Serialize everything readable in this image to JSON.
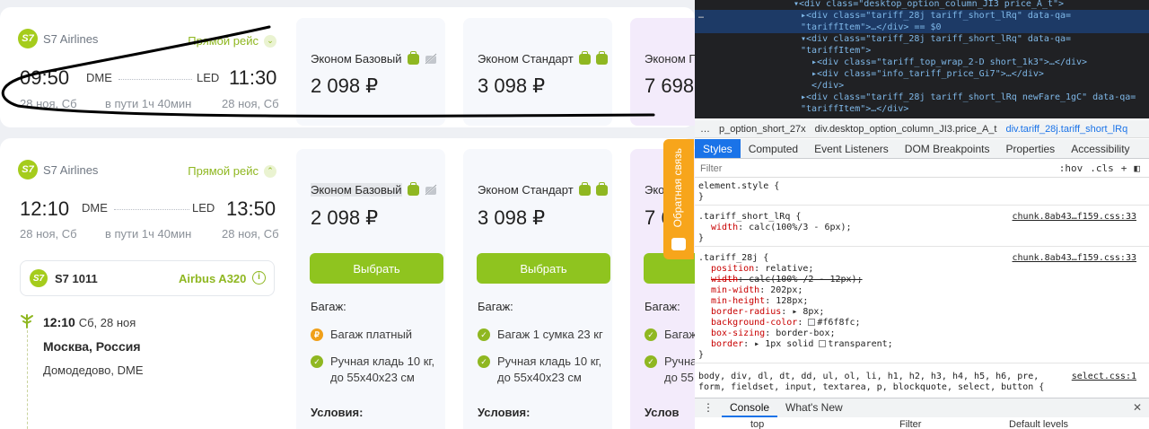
{
  "flights": [
    {
      "airline": "S7 Airlines",
      "logo": "S7",
      "direct_label": "Прямой рейс",
      "chevron": "⌄",
      "depart_time": "09:50",
      "depart_code": "DME",
      "arrive_code": "LED",
      "arrive_time": "11:30",
      "depart_date": "28 ноя, Сб",
      "duration": "в пути 1ч 40мин",
      "arrive_date": "28 ноя, Сб",
      "tariffs": [
        {
          "title": "Эконом Базовый",
          "price": "2 098 ₽"
        },
        {
          "title": "Эконом Стандарт",
          "price": "3 098 ₽"
        },
        {
          "title": "Эконом Г",
          "price": "7 698"
        }
      ]
    },
    {
      "airline": "S7 Airlines",
      "logo": "S7",
      "direct_label": "Прямой рейс",
      "chevron": "⌃",
      "depart_time": "12:10",
      "depart_code": "DME",
      "arrive_code": "LED",
      "arrive_time": "13:50",
      "depart_date": "28 ноя, Сб",
      "duration": "в пути 1ч 40мин",
      "arrive_date": "28 ноя, Сб",
      "tariffs": [
        {
          "title": "Эконом Базовый",
          "price": "2 098 ₽",
          "select": "Выбрать",
          "baggage_label": "Багаж:",
          "f1": "Багаж платный",
          "f2": "Ручная кладь 10 кг,",
          "f2b": "до 55x40x23 см",
          "conditions": "Условия:"
        },
        {
          "title": "Эконом Стандарт",
          "price": "3 098 ₽",
          "select": "Выбрать",
          "baggage_label": "Багаж:",
          "f1": "Багаж 1 сумка 23 кг",
          "f2": "Ручная кладь 10 кг,",
          "f2b": "до 55x40x23 см",
          "conditions": "Условия:"
        },
        {
          "title": "Эконом",
          "price": "7 6",
          "select": "",
          "baggage_label": "Багаж:",
          "f1": "Багаж",
          "f2": "Ручна",
          "f2b": "до 55",
          "conditions": "Услов"
        }
      ],
      "segment": {
        "flight_no": "S7 1011",
        "aircraft": "Airbus A320",
        "time": "12:10",
        "date": "Сб, 28 ноя",
        "city": "Москва, Россия",
        "airport": "Домодедово, DME"
      }
    }
  ],
  "feedback_label": "Обратная связь",
  "devtools": {
    "dom_lines": [
      {
        "t": "▾<div class=\"desktop_option_column_JI3 price_A_t\">",
        "indent": 110,
        "sel": false
      },
      {
        "t": "▸<div class=\"tariff_28j tariff_short_lRq\" data-qa=",
        "indent": 118,
        "sel": true,
        "prefix": "…"
      },
      {
        "t": "\"tariffItem\">…</div> == $0",
        "indent": 118,
        "sel": true
      },
      {
        "t": "▾<div class=\"tariff_28j tariff_short_lRq\" data-qa=",
        "indent": 118,
        "sel": false
      },
      {
        "t": "\"tariffItem\">",
        "indent": 118,
        "sel": false
      },
      {
        "t": "▸<div class=\"tariff_top_wrap_2-D short_1k3\">…</div>",
        "indent": 130,
        "sel": false
      },
      {
        "t": "▸<div class=\"info_tariff_price_Gi7\">…</div>",
        "indent": 130,
        "sel": false
      },
      {
        "t": "</div>",
        "indent": 130,
        "sel": false
      },
      {
        "t": "▸<div class=\"tariff_28j tariff_short_lRq newFare_1gC\" data-qa=",
        "indent": 118,
        "sel": false
      },
      {
        "t": "\"tariffItem\">…</div>",
        "indent": 118,
        "sel": false
      }
    ],
    "breadcrumbs": [
      "…",
      "p_option_short_27x",
      "div.desktop_option_column_JI3.price_A_t",
      "div.tariff_28j.tariff_short_lRq"
    ],
    "tabs": [
      "Styles",
      "Computed",
      "Event Listeners",
      "DOM Breakpoints",
      "Properties",
      "Accessibility"
    ],
    "filter_placeholder": "Filter",
    "filter_tools": [
      ":hov",
      ".cls",
      "+"
    ],
    "rules": [
      {
        "selector": "element.style {",
        "source": "",
        "decls": [],
        "close": "}"
      },
      {
        "selector": ".tariff_short_lRq {",
        "source": "chunk.8ab43…f159.css:33",
        "decls": [
          {
            "p": "width",
            "v": "calc(100%/3 - 6px);",
            "strike": false
          }
        ],
        "close": "}"
      },
      {
        "selector": ".tariff_28j {",
        "source": "chunk.8ab43…f159.css:33",
        "decls": [
          {
            "p": "position",
            "v": "relative;",
            "strike": false
          },
          {
            "p": "width",
            "v": "calc(100% /2 - 12px);",
            "strike": true
          },
          {
            "p": "min-width",
            "v": "202px;",
            "strike": false
          },
          {
            "p": "min-height",
            "v": "128px;",
            "strike": false
          },
          {
            "p": "border-radius",
            "v": "▸ 8px;",
            "strike": false
          },
          {
            "p": "background-color",
            "v": "#f6f8fc;",
            "strike": false,
            "swatch": "#f6f8fc"
          },
          {
            "p": "box-sizing",
            "v": "border-box;",
            "strike": false
          },
          {
            "p": "border",
            "v": "▸ 1px solid ",
            "strike": false,
            "tail": "transparent;",
            "swatch2": "#ffffff"
          }
        ],
        "close": "}"
      }
    ],
    "reset_rule": "body, div, dl, dt, dd, ul, ol, li, h1, h2, h3, h4, h5, h6, pre,",
    "reset_rule2": "form, fieldset, input, textarea, p, blockquote, select, button {",
    "reset_src": "select.css:1",
    "console_tabs": [
      "Console",
      "What's New"
    ],
    "console_close": "✕",
    "bottom_items": [
      "top",
      "Filter",
      "Default levels"
    ]
  }
}
